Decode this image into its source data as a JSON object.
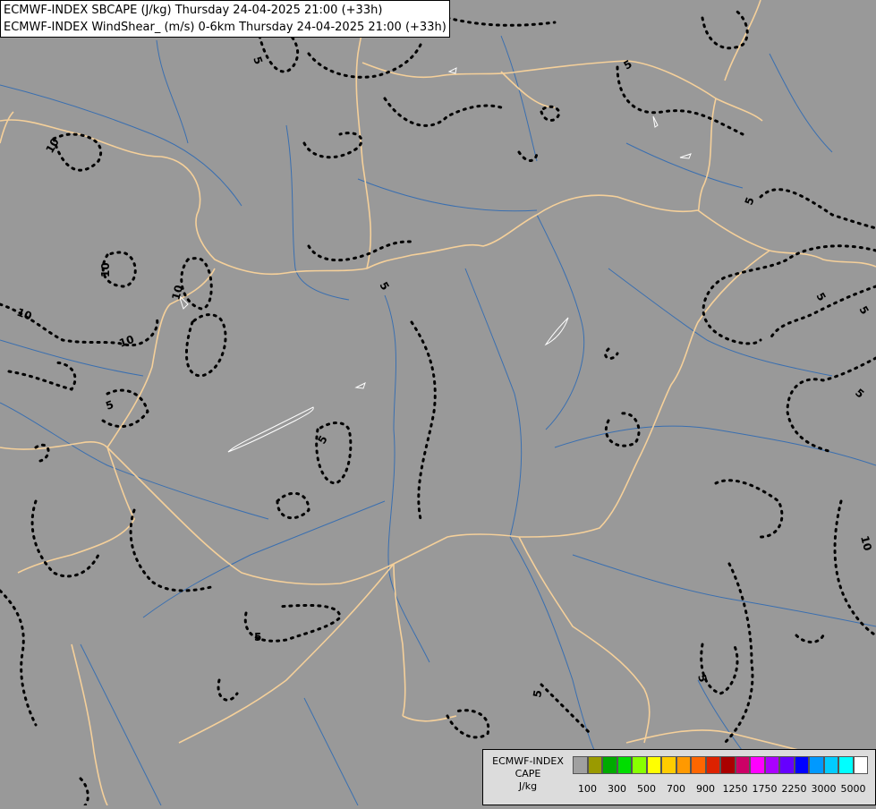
{
  "header": {
    "line1": "ECMWF-INDEX SBCAPE (J/kg) Thursday 24-04-2025 21:00 (+33h)",
    "line2": "ECMWF-INDEX WindShear_ (m/s) 0-6km Thursday 24-04-2025 21:00 (+33h)"
  },
  "contour_labels": [
    "5",
    "10",
    "10",
    "10",
    "10",
    "10",
    "5",
    "5",
    "5",
    "5",
    "5",
    "5",
    "5",
    "5",
    "5",
    "5",
    "10",
    "5"
  ],
  "legend": {
    "title_line1": "ECMWF-INDEX",
    "title_line2": "CAPE",
    "unit": "J/kg",
    "tick_labels": [
      "100",
      "300",
      "500",
      "700",
      "900",
      "1250",
      "1750",
      "2250",
      "3000",
      "5000"
    ],
    "colors": [
      "#a0a0a0",
      "#9a9a00",
      "#00aa00",
      "#00dd00",
      "#88ff00",
      "#ffff00",
      "#ffcc00",
      "#ff9900",
      "#ff6600",
      "#dd2200",
      "#aa0000",
      "#cc0066",
      "#ff00ff",
      "#aa00ff",
      "#6600ff",
      "#0000ff",
      "#0099ff",
      "#00ccff",
      "#00ffff",
      "#ffffff"
    ]
  },
  "colors": {
    "background": "#999999",
    "borders": "#f5d09a",
    "rivers": "#3a6fb0",
    "contours": "#000000",
    "lakes": "#ffffff"
  }
}
